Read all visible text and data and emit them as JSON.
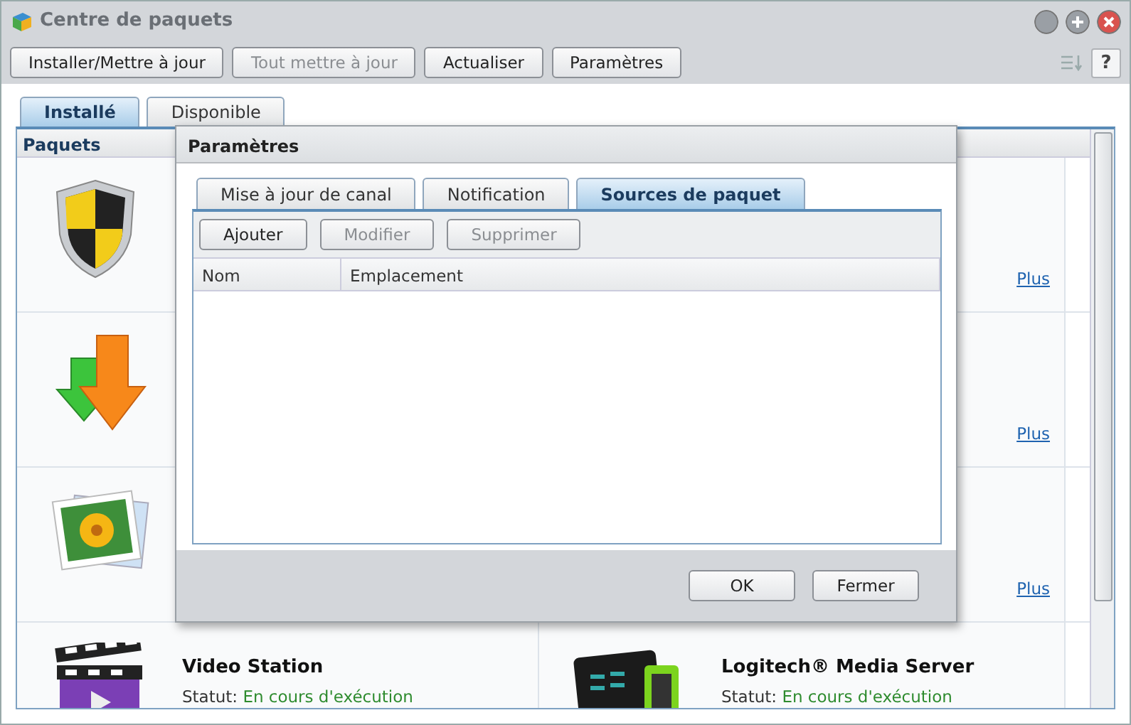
{
  "window": {
    "title": "Centre de paquets",
    "controls": [
      {
        "kind": "minimize"
      },
      {
        "kind": "maximize"
      },
      {
        "kind": "close"
      }
    ]
  },
  "toolbar": {
    "buttons": [
      {
        "label": "Installer/Mettre à jour",
        "disabled": false
      },
      {
        "label": "Tout mettre à jour",
        "disabled": true
      },
      {
        "label": "Actualiser",
        "disabled": false
      },
      {
        "label": "Paramètres",
        "disabled": false
      }
    ],
    "help": "?"
  },
  "tabs": [
    {
      "label": "Installé",
      "selected": true
    },
    {
      "label": "Disponible",
      "selected": false
    }
  ],
  "grid": {
    "header": "Paquets",
    "rows": [
      [
        {
          "kind": "shield"
        },
        {
          "link": "Plus"
        }
      ],
      [
        {
          "kind": "arrows"
        },
        {
          "link": "Plus"
        }
      ],
      [
        {
          "kind": "photo"
        },
        {
          "link": "Plus"
        }
      ],
      [
        {
          "kind": "video",
          "name": "Video Station",
          "status_label": "Statut:",
          "status": "En cours d'exécution"
        },
        {
          "kind": "media",
          "name": "Logitech® Media Server",
          "status_label": "Statut:",
          "status": "En cours d'exécution"
        }
      ]
    ]
  },
  "dialog": {
    "title": "Paramètres",
    "tabs": [
      {
        "label": "Mise à jour de canal",
        "selected": false
      },
      {
        "label": "Notification",
        "selected": false
      },
      {
        "label": "Sources de paquet",
        "selected": true
      }
    ],
    "buttons": [
      {
        "label": "Ajouter",
        "disabled": false
      },
      {
        "label": "Modifier",
        "disabled": true
      },
      {
        "label": "Supprimer",
        "disabled": true
      }
    ],
    "columns": [
      "Nom",
      "Emplacement"
    ],
    "footer": [
      "OK",
      "Fermer"
    ]
  }
}
